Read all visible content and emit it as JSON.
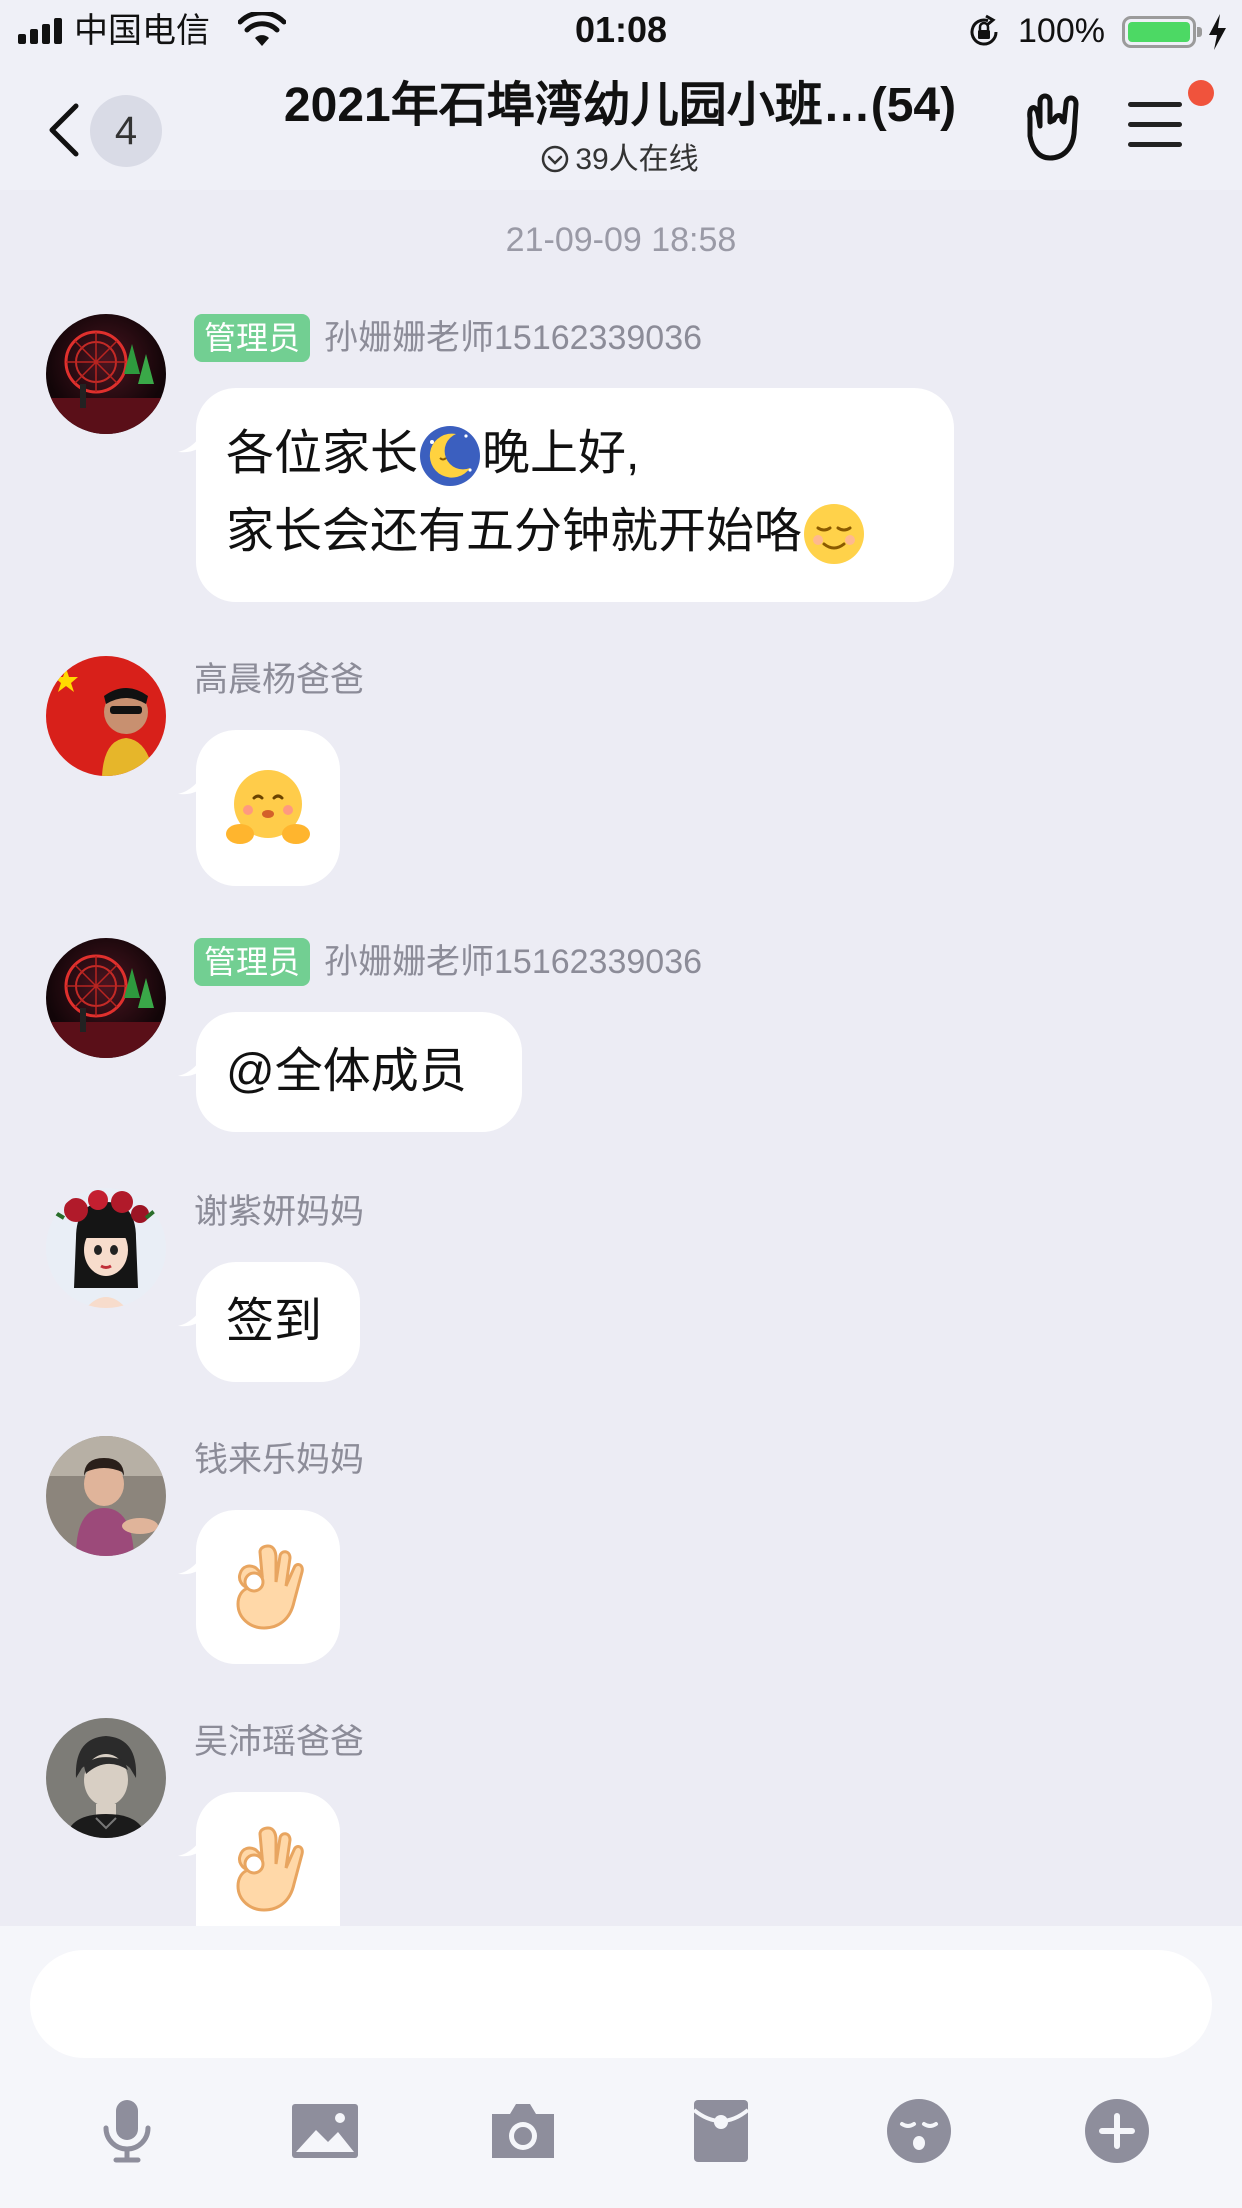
{
  "status_bar": {
    "carrier": "中国电信",
    "time": "01:08",
    "battery_percent": "100%",
    "battery_level": 1.0,
    "charging": true
  },
  "header": {
    "back_icon": "chevron-left-icon",
    "unread_count": "4",
    "title": "2021年石埠湾幼儿园小班…(54)",
    "online_status": "39人在线",
    "gesture_icon": "rock-hand-icon",
    "menu_icon": "hamburger-menu-icon",
    "menu_has_notification": true
  },
  "chat": {
    "timestamp": "21-09-09 18:58",
    "messages": [
      {
        "role": "管理员",
        "sender": "孙姗姗老师15162339036",
        "line1_a": "各位家长",
        "line1_emoji": "moon-emoji",
        "line1_b": "晚上好,",
        "line2": "家长会还有五分钟就开始咯",
        "line2_emoji": "smiling-face-emoji"
      },
      {
        "sender": "高晨杨爸爸",
        "emoji": "hugging-face-emoji"
      },
      {
        "role": "管理员",
        "sender": "孙姗姗老师15162339036",
        "text": "@全体成员"
      },
      {
        "sender": "谢紫妍妈妈",
        "text": "签到"
      },
      {
        "sender": "钱来乐妈妈",
        "emoji": "ok-hand-emoji"
      },
      {
        "sender": "吴沛瑶爸爸",
        "emoji": "ok-hand-emoji"
      }
    ]
  },
  "input": {
    "placeholder": "",
    "toolbar": [
      "microphone-icon",
      "image-icon",
      "camera-icon",
      "red-packet-icon",
      "emoji-icon",
      "plus-icon"
    ]
  },
  "colors": {
    "background": "#ececf4",
    "header_background": "#eff0f7",
    "admin_tag": "#72cf92",
    "notification_dot": "#f0533c",
    "battery_fill": "#4cd964",
    "toolbar_icon": "#8e8e9c"
  }
}
